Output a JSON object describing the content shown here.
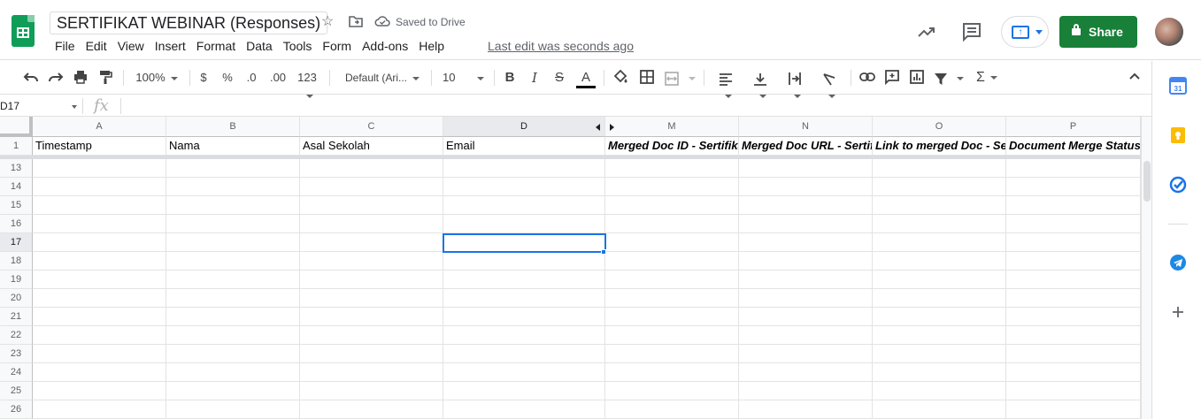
{
  "header": {
    "doc_title": "SERTIFIKAT WEBINAR (Responses)",
    "saved_status": "Saved to Drive",
    "last_edit": "Last edit was seconds ago",
    "share_label": "Share",
    "menu": [
      "File",
      "Edit",
      "View",
      "Insert",
      "Format",
      "Data",
      "Tools",
      "Form",
      "Add-ons",
      "Help"
    ]
  },
  "toolbar": {
    "zoom": "100%",
    "currency": "$",
    "percent": "%",
    "dec_decrease": ".0",
    "dec_increase": ".00",
    "more_formats": "123",
    "font": "Default (Ari...",
    "font_size": "10",
    "bold": "B",
    "italic": "I",
    "strike": "S",
    "textcolor": "A",
    "sum": "Σ"
  },
  "formula_bar": {
    "name_box": "D17",
    "fx": "fx"
  },
  "sheet": {
    "columns": [
      "A",
      "B",
      "C",
      "D",
      "M",
      "N",
      "O",
      "P"
    ],
    "header_row_number": "1",
    "headers": [
      "Timestamp",
      "Nama",
      "Asal Sekolah",
      "Email",
      "Merged Doc ID - Sertifikat",
      "Merged Doc URL - Sertifikat",
      "Link to merged Doc - Sertifikat",
      "Document Merge Status"
    ],
    "rows": [
      "13",
      "14",
      "15",
      "16",
      "17",
      "18",
      "19",
      "20",
      "21",
      "22",
      "23",
      "24",
      "25",
      "26"
    ],
    "selected_cell": "D17"
  },
  "colors": {
    "accent": "#1a73e8",
    "share": "#188038",
    "sheets_green": "#0f9d58"
  }
}
